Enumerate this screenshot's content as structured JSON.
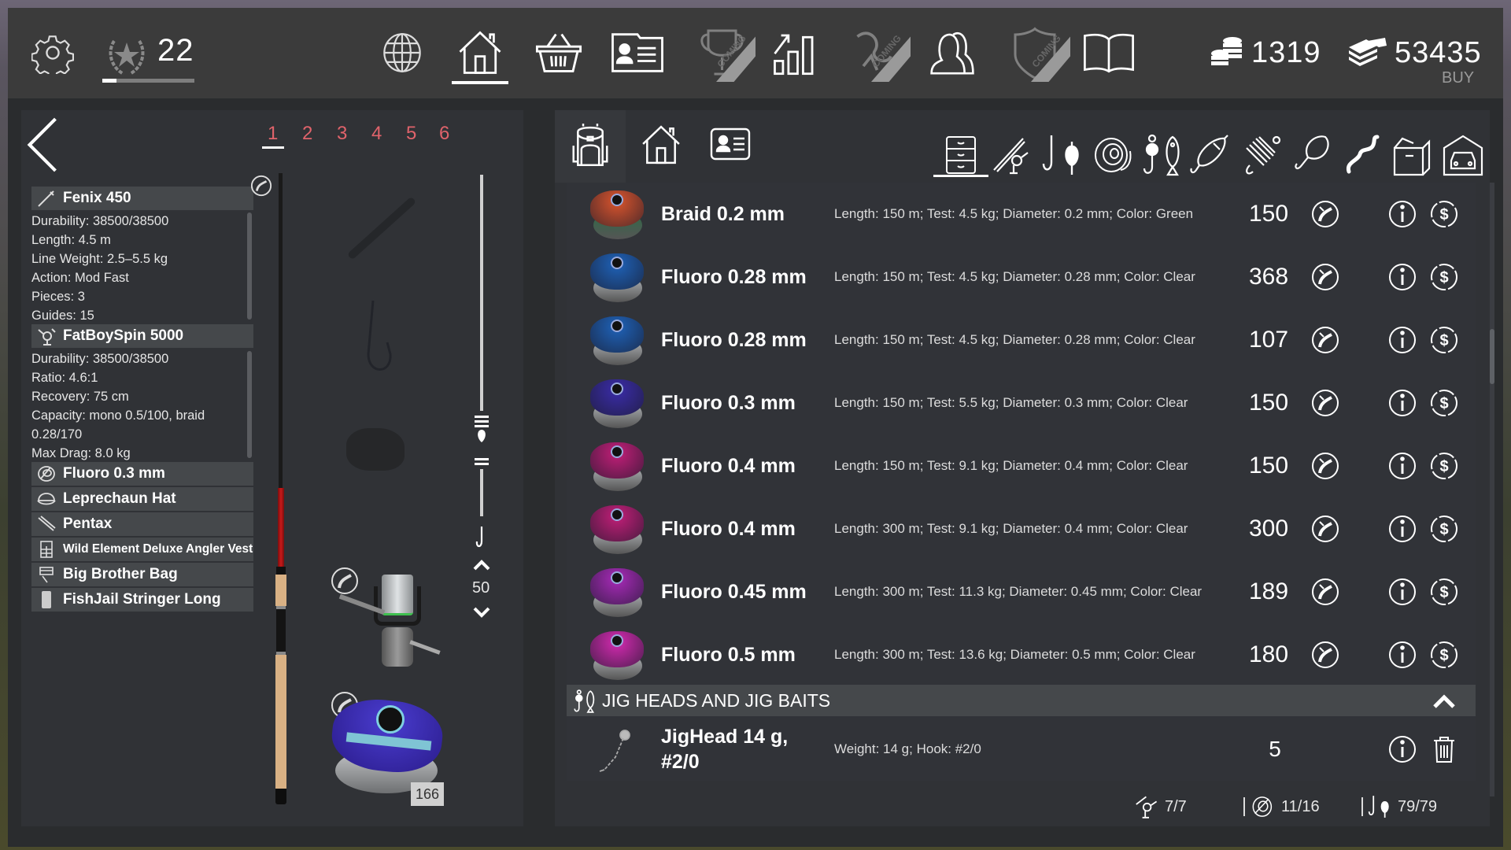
{
  "topbar": {
    "level": "22",
    "level_progress": 0.15,
    "nav_icons": [
      "globe-icon",
      "home-icon",
      "shop-basket-icon",
      "profile-card-icon",
      "trophy-icon",
      "stats-icon",
      "license-icon",
      "friends-icon",
      "clubs-icon",
      "encyclopedia-icon"
    ],
    "coming_label": "COMING",
    "active_nav": "home-icon",
    "silver": "1319",
    "gold": "53435",
    "buy_label": "BUY"
  },
  "left": {
    "slots": [
      "1",
      "2",
      "3",
      "4",
      "5",
      "6"
    ],
    "active_slot": "1",
    "rod": {
      "name": "Fenix 450",
      "stats": [
        "Durability: 38500/38500",
        "Length: 4.5 m",
        "Line Weight: 2.5–5.5 kg",
        "Action: Mod Fast",
        "Pieces: 3",
        "Guides: 15"
      ]
    },
    "reel": {
      "name": "FatBoySpin 5000",
      "stats": [
        "Durability: 38500/38500",
        "Ratio: 4.6:1",
        "Recovery: 75 cm",
        "Capacity: mono 0.5/100, braid 0.28/170",
        "Max Drag: 8.0 kg"
      ]
    },
    "gear": [
      {
        "name": "Fluoro 0.3 mm",
        "icon": "line-spool-icon"
      },
      {
        "name": "Leprechaun Hat",
        "icon": "hat-icon"
      },
      {
        "name": "Pentax",
        "icon": "sunglasses-icon"
      },
      {
        "name": "Wild Element Deluxe Angler Vest",
        "icon": "vest-icon"
      },
      {
        "name": "Big Brother Bag",
        "icon": "bag-icon"
      },
      {
        "name": "FishJail Stringer Long",
        "icon": "stringer-icon"
      }
    ],
    "leader_length": "50",
    "line_spool_count": "166"
  },
  "right": {
    "location_tabs": [
      "backpack-icon",
      "home-icon",
      "profile-card-icon"
    ],
    "category_tabs": [
      "all-storage-icon",
      "rods-reels-icon",
      "hooks-floats-icon",
      "lines-icon",
      "jig-baits-icon",
      "lures-icon",
      "flies-icon",
      "spoons-icon",
      "worms-icon",
      "misc-box-icon",
      "garage-icon"
    ],
    "active_category": "all-storage-icon",
    "items": [
      {
        "name": "Braid 0.2 mm",
        "desc": "Length: 150 m; Test: 4.5 kg; Diameter: 0.2 mm; Color: Green",
        "qty": "150",
        "spool_color": "#d9542c",
        "spool_body": "#2d6b45"
      },
      {
        "name": "Fluoro 0.28 mm",
        "desc": "Length: 150 m; Test: 4.5 kg; Diameter: 0.28 mm; Color: Clear",
        "qty": "368",
        "spool_color": "#1e62b8",
        "spool_body": "#b8bcc0"
      },
      {
        "name": "Fluoro 0.28 mm",
        "desc": "Length: 150 m; Test: 4.5 kg; Diameter: 0.28 mm; Color: Clear",
        "qty": "107",
        "spool_color": "#1e62b8",
        "spool_body": "#b8bcc0"
      },
      {
        "name": "Fluoro 0.3 mm",
        "desc": "Length: 150 m; Test: 5.5 kg; Diameter: 0.3 mm; Color: Clear",
        "qty": "150",
        "spool_color": "#3a2ca8",
        "spool_body": "#b8bcc0"
      },
      {
        "name": "Fluoro 0.4 mm",
        "desc": "Length: 150 m; Test: 9.1 kg; Diameter: 0.4 mm; Color: Clear",
        "qty": "150",
        "spool_color": "#c21e78",
        "spool_body": "#b8bcc0"
      },
      {
        "name": "Fluoro 0.4 mm",
        "desc": "Length: 300 m; Test: 9.1 kg; Diameter: 0.4 mm; Color: Clear",
        "qty": "300",
        "spool_color": "#c21e78",
        "spool_body": "#b8bcc0"
      },
      {
        "name": "Fluoro 0.45 mm",
        "desc": "Length: 300 m; Test: 11.3 kg; Diameter: 0.45 mm; Color: Clear",
        "qty": "189",
        "spool_color": "#a82ab8",
        "spool_body": "#b8bcc0"
      },
      {
        "name": "Fluoro 0.5 mm",
        "desc": "Length: 300 m; Test: 13.6 kg; Diameter: 0.5 mm; Color: Clear",
        "qty": "180",
        "spool_color": "#d42ab0",
        "spool_body": "#b8bcc0"
      }
    ],
    "section": {
      "title": "JIG HEADS AND JIG BAITS"
    },
    "jig_items": [
      {
        "name_line1": "JigHead 14 g,",
        "name_line2": "#2/0",
        "desc": "Weight: 14 g; Hook: #2/0",
        "qty": "5"
      }
    ],
    "footer": {
      "rods": "7/7",
      "lines": "11/16",
      "tackle": "79/79"
    }
  }
}
